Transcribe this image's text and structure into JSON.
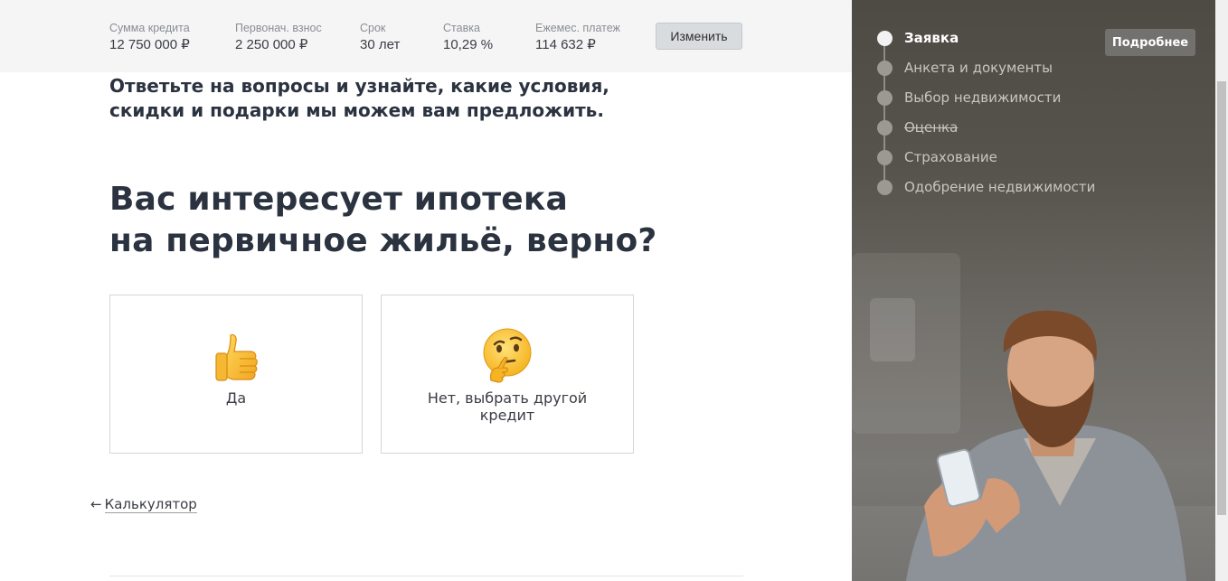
{
  "summary": {
    "items": [
      {
        "label": "Сумма кредита",
        "value": "12 750 000 ₽"
      },
      {
        "label": "Первонач. взнос",
        "value": "2 250 000 ₽"
      },
      {
        "label": "Срок",
        "value": "30 лет"
      },
      {
        "label": "Ставка",
        "value": "10,29 %"
      },
      {
        "label": "Ежемес. платеж",
        "value": "114 632 ₽"
      }
    ],
    "change_label": "Изменить"
  },
  "main": {
    "intro": "Ответьте на вопросы и узнайте, какие условия, скидки и подарки мы можем вам предложить.",
    "question_line1": "Вас интересует ипотека",
    "question_line2": "на первичное жильё, верно?",
    "options": [
      {
        "label": "Да",
        "icon": "thumbs-up-icon"
      },
      {
        "label": "Нет, выбрать другой кредит",
        "icon": "thinking-face-icon"
      }
    ],
    "back_link": {
      "arrow": "←",
      "label": "Калькулятор"
    }
  },
  "sidebar": {
    "details_label": "Подробнее",
    "steps": [
      {
        "label": "Заявка",
        "state": "active"
      },
      {
        "label": "Анкета и документы",
        "state": "pending"
      },
      {
        "label": "Выбор недвижимости",
        "state": "pending"
      },
      {
        "label": "Оценка",
        "state": "struck"
      },
      {
        "label": "Страхование",
        "state": "pending"
      },
      {
        "label": "Одобрение недвижимости",
        "state": "pending"
      }
    ]
  },
  "colors": {
    "heading": "#2b3340",
    "summary_bg": "#f5f5f5",
    "panel_bg": "#57534d",
    "step_active": "#ffffff",
    "step_inactive": "#c9c6c0"
  }
}
